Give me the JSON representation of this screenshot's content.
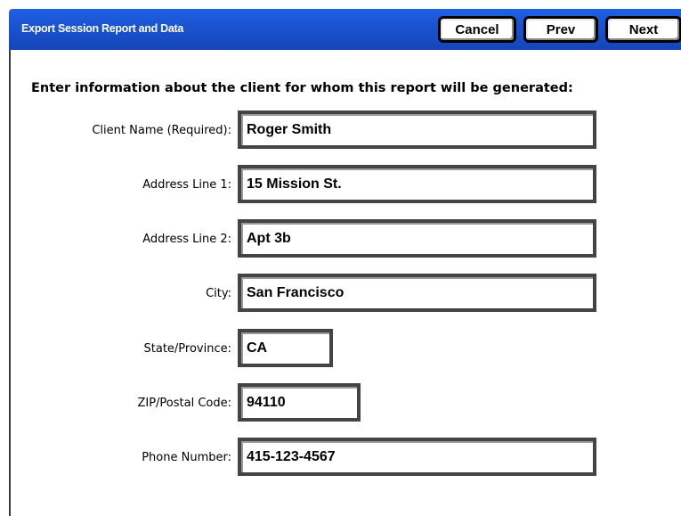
{
  "header": {
    "title": "Export Session Report and Data",
    "cancel_label": "Cancel",
    "prev_label": "Prev",
    "next_label": "Next"
  },
  "instruction": "Enter information about the client for whom this report will be generated:",
  "fields": [
    {
      "label": "Client Name (Required):",
      "value": "Roger Smith"
    },
    {
      "label": "Address Line 1:",
      "value": "15 Mission St."
    },
    {
      "label": "Address Line 2:",
      "value": "Apt 3b"
    },
    {
      "label": "City:",
      "value": "San Francisco"
    },
    {
      "label": "State/Province:",
      "value": "CA"
    },
    {
      "label": "ZIP/Postal Code:",
      "value": "94110"
    },
    {
      "label": "Phone Number:",
      "value": "415-123-4567"
    }
  ],
  "colors": {
    "titlebar": "#1a52cf",
    "title_text": "#ffffff"
  }
}
